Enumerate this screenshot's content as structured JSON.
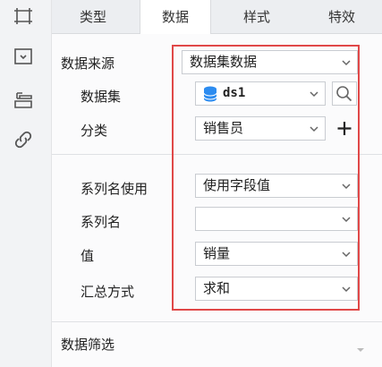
{
  "tabs": [
    {
      "label": "类型"
    },
    {
      "label": "数据"
    },
    {
      "label": "样式"
    },
    {
      "label": "特效"
    }
  ],
  "active_tab": "数据",
  "rail_icons": [
    "frame-icon",
    "widget-icon",
    "layout-icon",
    "link-icon"
  ],
  "data_source": {
    "label": "数据来源",
    "value": "数据集数据"
  },
  "dataset": {
    "label": "数据集",
    "value": "ds1"
  },
  "category": {
    "label": "分类",
    "value": "销售员"
  },
  "series_use": {
    "label": "系列名使用",
    "value": "使用字段值"
  },
  "series_name": {
    "label": "系列名",
    "value": ""
  },
  "value_field": {
    "label": "值",
    "value": "销量"
  },
  "summary": {
    "label": "汇总方式",
    "value": "求和"
  },
  "filter": {
    "label": "数据筛选"
  },
  "colors": {
    "accent_blue": "#2d8cf0",
    "highlight": "#e04848"
  }
}
